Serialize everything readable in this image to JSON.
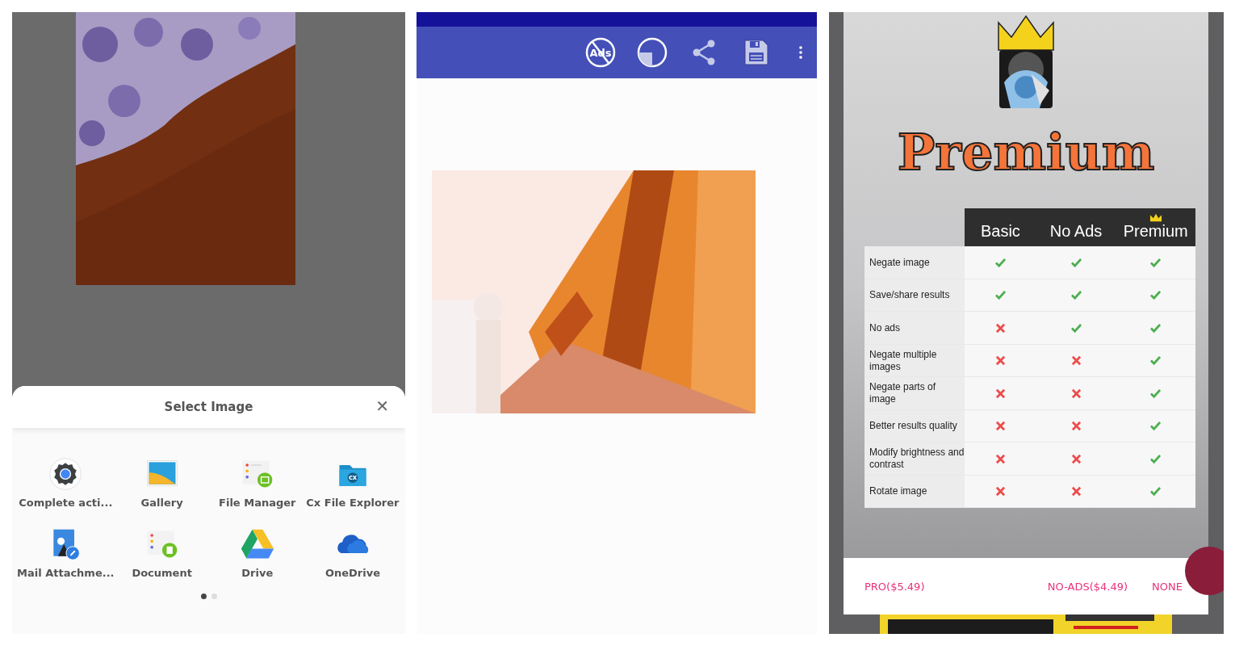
{
  "chooser": {
    "title": "Select Image",
    "close": "✕",
    "apps": [
      {
        "label": "Complete acti...",
        "kind": "gear"
      },
      {
        "label": "Gallery",
        "kind": "gallery"
      },
      {
        "label": "File Manager",
        "kind": "files"
      },
      {
        "label": "Cx File Explorer",
        "kind": "cx",
        "badge": "cx"
      },
      {
        "label": "Mail Attachme...",
        "kind": "mail"
      },
      {
        "label": "Document",
        "kind": "document"
      },
      {
        "label": "Drive",
        "kind": "drive"
      },
      {
        "label": "OneDrive",
        "kind": "onedrive"
      }
    ],
    "pages": [
      {
        "selected": true
      },
      {
        "selected": false
      }
    ]
  },
  "editor": {
    "toolbar": [
      {
        "kind": "noads",
        "label": "Ads"
      },
      {
        "kind": "crop"
      },
      {
        "kind": "share"
      },
      {
        "kind": "save"
      },
      {
        "kind": "more"
      }
    ]
  },
  "premium": {
    "title": "Premium",
    "columns": [
      {
        "label": "Basic",
        "crown": false
      },
      {
        "label": "No Ads",
        "crown": false
      },
      {
        "label": "Premium",
        "crown": true
      }
    ],
    "rows": [
      {
        "feature": "Negate image",
        "included": [
          true,
          true,
          true
        ]
      },
      {
        "feature": "Save/share results",
        "included": [
          true,
          true,
          true
        ]
      },
      {
        "feature": "No ads",
        "included": [
          false,
          true,
          true
        ]
      },
      {
        "feature": "Negate multiple images",
        "included": [
          false,
          false,
          true
        ]
      },
      {
        "feature": "Negate parts of image",
        "included": [
          false,
          false,
          true
        ]
      },
      {
        "feature": "Better results quality",
        "included": [
          false,
          false,
          true
        ]
      },
      {
        "feature": "Modify brightness and contrast",
        "included": [
          false,
          false,
          true
        ]
      },
      {
        "feature": "Rotate image",
        "included": [
          false,
          false,
          true
        ]
      }
    ],
    "buttons": [
      "PRO($5.49)",
      "NO-ADS($4.49)",
      "NONE"
    ]
  }
}
